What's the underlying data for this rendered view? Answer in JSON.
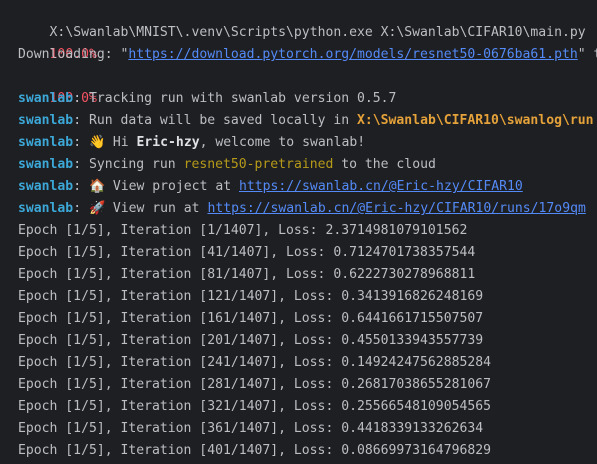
{
  "terminal": {
    "command": "X:\\Swanlab\\MNIST\\.venv\\Scripts\\python.exe X:\\Swanlab\\CIFAR10\\main.py",
    "progress_1": "100.0%",
    "downloading_prefix": "Downloading: \"",
    "download_url": "https://download.pytorch.org/models/resnet50-0676ba61.pth",
    "downloading_suffix": "\" to C:\\Users",
    "progress_2": "100.0%",
    "swanlab_prefix": "swanlab",
    "sep": ": ",
    "tracking_text": "Tracking run with swanlab version 0.5.7",
    "saved_text": "Run data will be saved locally in ",
    "saved_path": "X:\\Swanlab\\CIFAR10\\swanlog\\run",
    "hi_emoji": "👋",
    "hi_prefix": " Hi ",
    "user_name": "Eric-hzy",
    "hi_suffix": ", welcome to swanlab!",
    "sync_prefix": "Syncing run ",
    "run_name": "resnet50-pretrained",
    "sync_suffix": " to the cloud",
    "home_emoji": "🏠",
    "project_prefix": " View project at ",
    "project_url": "https://swanlab.cn/@Eric-hzy/CIFAR10",
    "rocket_emoji": "🚀",
    "run_prefix": " View run at ",
    "run_url": "https://swanlab.cn/@Eric-hzy/CIFAR10/runs/17o9qm"
  },
  "epochs": [
    "Epoch [1/5], Iteration [1/1407], Loss: 2.3714981079101562",
    "Epoch [1/5], Iteration [41/1407], Loss: 0.7124701738357544",
    "Epoch [1/5], Iteration [81/1407], Loss: 0.6222730278968811",
    "Epoch [1/5], Iteration [121/1407], Loss: 0.3413916826248169",
    "Epoch [1/5], Iteration [161/1407], Loss: 0.6441661715507507",
    "Epoch [1/5], Iteration [201/1407], Loss: 0.4550133943557739",
    "Epoch [1/5], Iteration [241/1407], Loss: 0.14924247562885284",
    "Epoch [1/5], Iteration [281/1407], Loss: 0.26817038655281067",
    "Epoch [1/5], Iteration [321/1407], Loss: 0.25566548109054565",
    "Epoch [1/5], Iteration [361/1407], Loss: 0.4418339133262634",
    "Epoch [1/5], Iteration [401/1407], Loss: 0.08669973164796829"
  ]
}
